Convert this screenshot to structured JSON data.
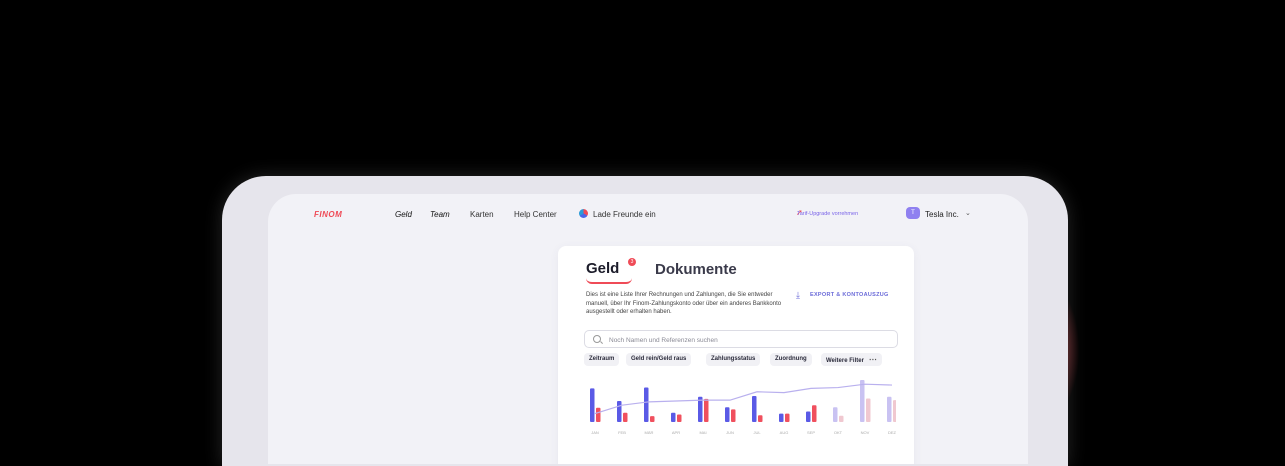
{
  "app": {
    "logo": "FINOM",
    "nav": [
      "Geld",
      "Team",
      "Karten",
      "Help Center",
      "Lade Freunde ein"
    ],
    "upgrade_label": "Tarif-Upgrade vorrehmen",
    "avatar_letter": "T",
    "company": "Tesla Inc."
  },
  "card": {
    "tabs": [
      "Geld",
      "Dokumente"
    ],
    "badge": "3",
    "description": "Dies ist eine Liste Ihrer Rechnungen und Zahlungen, die Sie entweder manuell, über Ihr Finom-Zahlungskonto oder über ein anderes Bankkonto ausgestellt oder erhalten haben.",
    "export_label": "EXPORT & KONTOAUSZUG",
    "search_placeholder": "Noch Namen und Referenzen suchen",
    "filters": [
      "Zeitraum",
      "Geld rein/Geld raus",
      "Zahlungsstatus",
      "Zuordnung",
      "Weitere Filter"
    ],
    "more_icon": "⋯"
  },
  "colors": {
    "accent": "#ef4b57",
    "income": "#5a5ae6",
    "expense": "#f0505e",
    "line": "#b9b0ee"
  },
  "chart_data": {
    "type": "bar",
    "categories": [
      "JAN",
      "FEB",
      "MÄR",
      "APR",
      "MAI",
      "JUN",
      "JUL",
      "AUG",
      "SEP",
      "OKT",
      "NOV",
      "DEZ"
    ],
    "series": [
      {
        "values": [
          80,
          50,
          82,
          22,
          60,
          35,
          62,
          20,
          25,
          35,
          100,
          60
        ]
      },
      {
        "values": [
          34,
          22,
          14,
          18,
          55,
          30,
          16,
          20,
          40,
          15,
          56,
          52
        ]
      }
    ],
    "line": [
      20,
      40,
      48,
      50,
      52,
      52,
      72,
      70,
      80,
      82,
      90,
      88
    ],
    "ylim": [
      0,
      100
    ]
  }
}
